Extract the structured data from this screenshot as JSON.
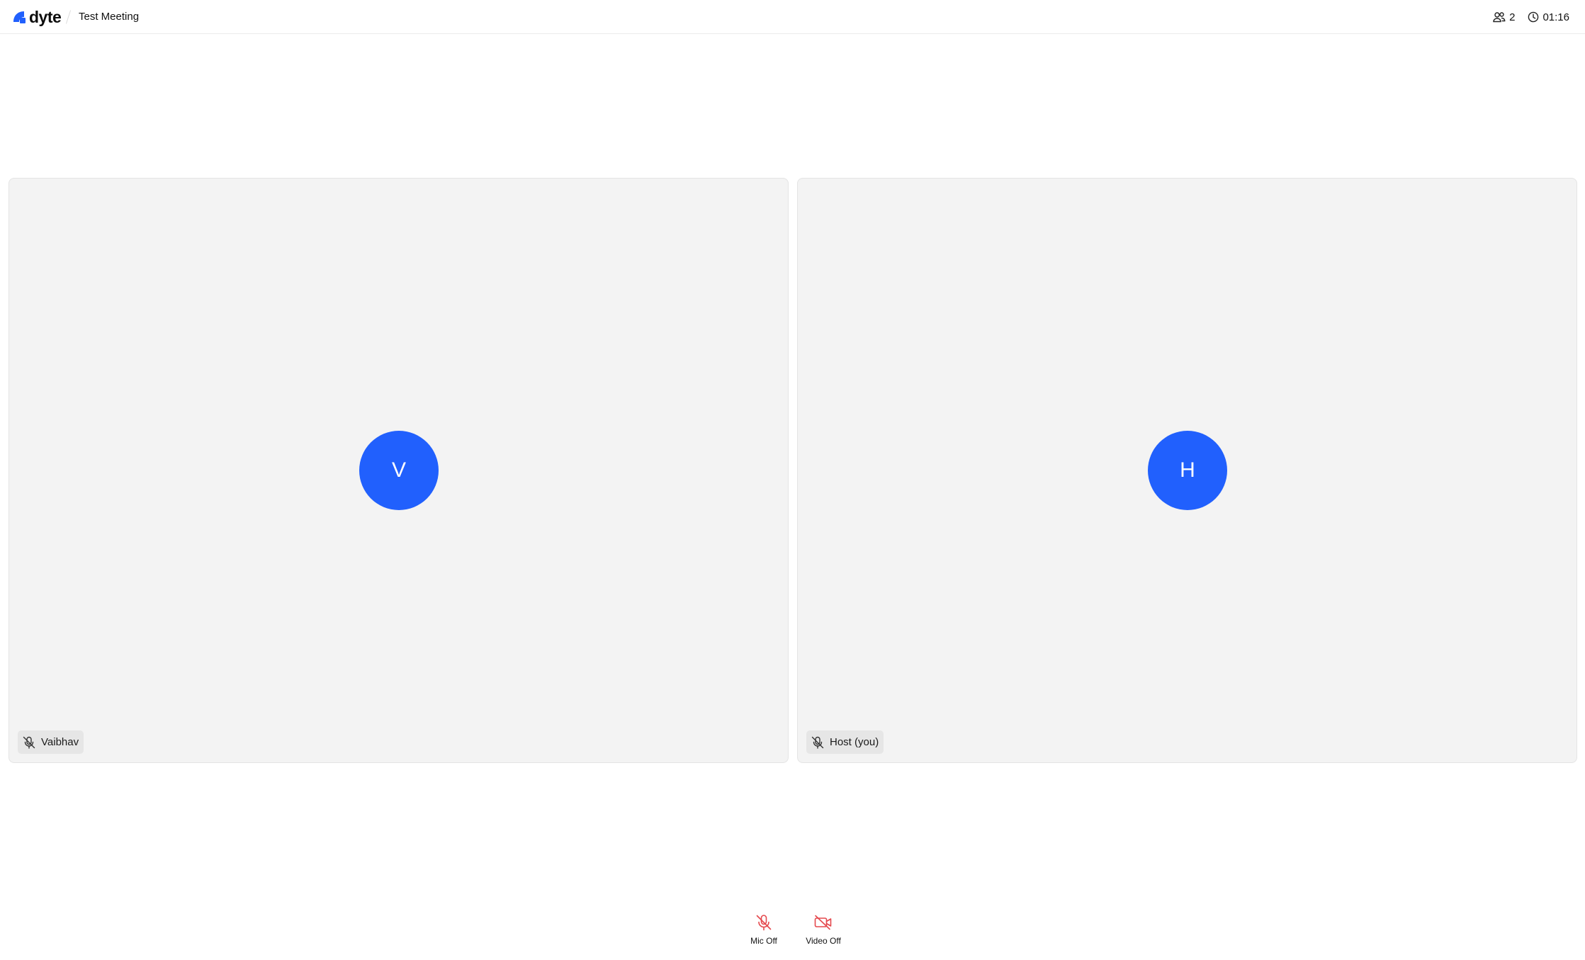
{
  "header": {
    "brand": "dyte",
    "meeting_title": "Test Meeting",
    "participant_count": "2",
    "timer": "01:16"
  },
  "participants": [
    {
      "name": "Vaibhav",
      "initial": "V",
      "mic": "off"
    },
    {
      "name": "Host (you)",
      "initial": "H",
      "mic": "off"
    }
  ],
  "controls": {
    "mic_label": "Mic Off",
    "video_label": "Video Off"
  },
  "colors": {
    "brand_blue": "#2160fd",
    "tile_bg": "#f3f3f3",
    "muted_red": "#e5484d"
  },
  "icons": [
    "dyte-logo-icon",
    "participants-icon",
    "clock-icon",
    "mic-off-icon",
    "video-off-icon"
  ]
}
